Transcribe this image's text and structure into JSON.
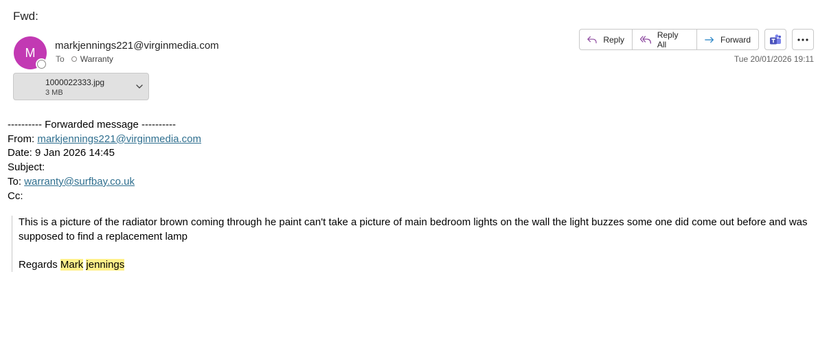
{
  "message": {
    "subject": "Fwd:",
    "sender_initial": "M",
    "sender_email": "markjennings221@virginmedia.com",
    "to_label": "To",
    "recipient": "Warranty",
    "timestamp": "Tue 20/01/2026 19:11"
  },
  "attachment": {
    "name": "1000022333.jpg",
    "size": "3 MB"
  },
  "actions": {
    "reply": "Reply",
    "reply_all": "Reply All",
    "forward": "Forward"
  },
  "forwarded": {
    "header": "---------- Forwarded message ----------",
    "from_label": "From: ",
    "from_email": "markjennings221@virginmedia.com",
    "date_line": "Date: 9 Jan 2026 14:45",
    "subject_line": "Subject:",
    "to_label": "To: ",
    "to_email": "warranty@surfbay.co.uk",
    "cc_line": "Cc:"
  },
  "quote": {
    "body": "This is a picture of the radiator brown coming through he paint can't take a picture of main bedroom lights on the wall the light buzzes some one did come out before and was supposed to find a replacement  lamp",
    "regards_prefix": "Regards ",
    "name_first": "Mark",
    "name_last": "jennings"
  },
  "colors": {
    "avatar": "#c239b3",
    "link": "#2f6f8f",
    "highlight": "#fff08a"
  },
  "icons": {
    "reply": "reply-arrow-icon",
    "reply_all": "reply-all-arrow-icon",
    "forward": "forward-arrow-icon",
    "teams": "teams-icon",
    "more": "more-options-icon",
    "chevron": "chevron-down-icon"
  }
}
